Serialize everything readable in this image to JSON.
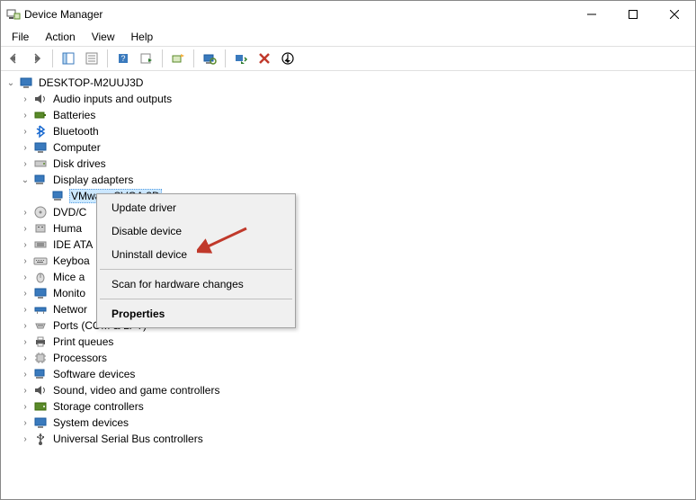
{
  "window": {
    "title": "Device Manager"
  },
  "menu": {
    "file": "File",
    "action": "Action",
    "view": "View",
    "help": "Help"
  },
  "tree": {
    "root": "DESKTOP-M2UUJ3D",
    "audio": "Audio inputs and outputs",
    "batteries": "Batteries",
    "bluetooth": "Bluetooth",
    "computer": "Computer",
    "disk": "Disk drives",
    "display_adapters": "Display adapters",
    "vmware_svga": "VMware SVGA 3D",
    "dvd": "DVD/C",
    "hid": "Huma",
    "ide": "IDE ATA",
    "keyboard": "Keyboa",
    "mice": "Mice a",
    "monitor": "Monito",
    "network": "Networ",
    "ports": "Ports (COM & LPT)",
    "print_queues": "Print queues",
    "processors": "Processors",
    "software_devices": "Software devices",
    "sound": "Sound, video and game controllers",
    "storage": "Storage controllers",
    "system_devices": "System devices",
    "usb": "Universal Serial Bus controllers"
  },
  "context_menu": {
    "update": "Update driver",
    "disable": "Disable device",
    "uninstall": "Uninstall device",
    "scan": "Scan for hardware changes",
    "properties": "Properties"
  },
  "colors": {
    "selection_bg": "#cce8ff",
    "arrow": "#c0392b"
  }
}
